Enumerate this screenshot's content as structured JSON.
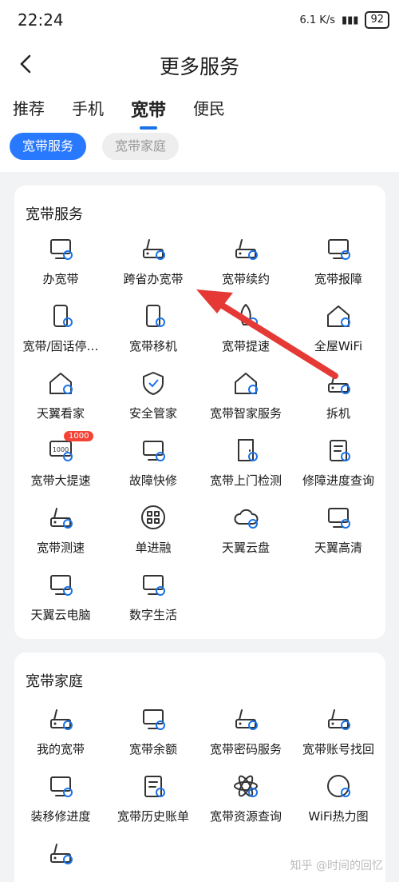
{
  "status": {
    "time": "22:24",
    "network": "6.1 K/s",
    "battery": "92"
  },
  "header": {
    "title": "更多服务"
  },
  "tabs": [
    "推荐",
    "手机",
    "宽带",
    "便民"
  ],
  "chips": [
    "宽带服务",
    "宽带家庭"
  ],
  "section1": {
    "title": "宽带服务",
    "items": [
      {
        "label": "办宽带",
        "icon": "monitor-antenna-icon"
      },
      {
        "label": "跨省办宽带",
        "icon": "router-plus-icon"
      },
      {
        "label": "宽带续约",
        "icon": "router-yen-icon"
      },
      {
        "label": "宽带报障",
        "icon": "monitor-alert-icon"
      },
      {
        "label": "宽带/固话停…",
        "icon": "phone-wifi-icon"
      },
      {
        "label": "宽带移机",
        "icon": "phone-move-icon"
      },
      {
        "label": "宽带提速",
        "icon": "rocket-icon"
      },
      {
        "label": "全屋WiFi",
        "icon": "home-wifi-icon"
      },
      {
        "label": "天翼看家",
        "icon": "home-eye-icon"
      },
      {
        "label": "安全管家",
        "icon": "shield-check-icon"
      },
      {
        "label": "宽带智家服务",
        "icon": "home-signal-icon"
      },
      {
        "label": "拆机",
        "icon": "router-gear-icon"
      },
      {
        "label": "宽带大提速",
        "icon": "speed-1000-icon",
        "badge": "1000",
        "text": "1000"
      },
      {
        "label": "故障快修",
        "icon": "monitor-alert-icon"
      },
      {
        "label": "宽带上门检测",
        "icon": "door-icon"
      },
      {
        "label": "修障进度查询",
        "icon": "clipboard-search-icon"
      },
      {
        "label": "宽带测速",
        "icon": "router-gauge-icon"
      },
      {
        "label": "单进融",
        "icon": "grid-icon"
      },
      {
        "label": "天翼云盘",
        "icon": "cloud-upload-icon"
      },
      {
        "label": "天翼高清",
        "icon": "tv-icon"
      },
      {
        "label": "天翼云电脑",
        "icon": "monitor-cloud-icon"
      },
      {
        "label": "数字生活",
        "icon": "tv-x-icon"
      }
    ]
  },
  "section2": {
    "title": "宽带家庭",
    "items": [
      {
        "label": "我的宽带",
        "icon": "router-icon"
      },
      {
        "label": "宽带余额",
        "icon": "monitor-yen-icon"
      },
      {
        "label": "宽带密码服务",
        "icon": "router-dots-icon"
      },
      {
        "label": "宽带账号找回",
        "icon": "router-check-icon"
      },
      {
        "label": "装移修进度",
        "icon": "monitor-clock-icon"
      },
      {
        "label": "宽带历史账单",
        "icon": "bill-icon"
      },
      {
        "label": "宽带资源查询",
        "icon": "atom-icon"
      },
      {
        "label": "WiFi热力图",
        "icon": "wifi-gauge-icon"
      },
      {
        "label": "",
        "icon": "router-gear-icon"
      }
    ]
  },
  "watermark": "知乎 @时间的回忆",
  "colors": {
    "accent": "#2979ff",
    "arrow": "#e53935",
    "icon": "#333333"
  }
}
